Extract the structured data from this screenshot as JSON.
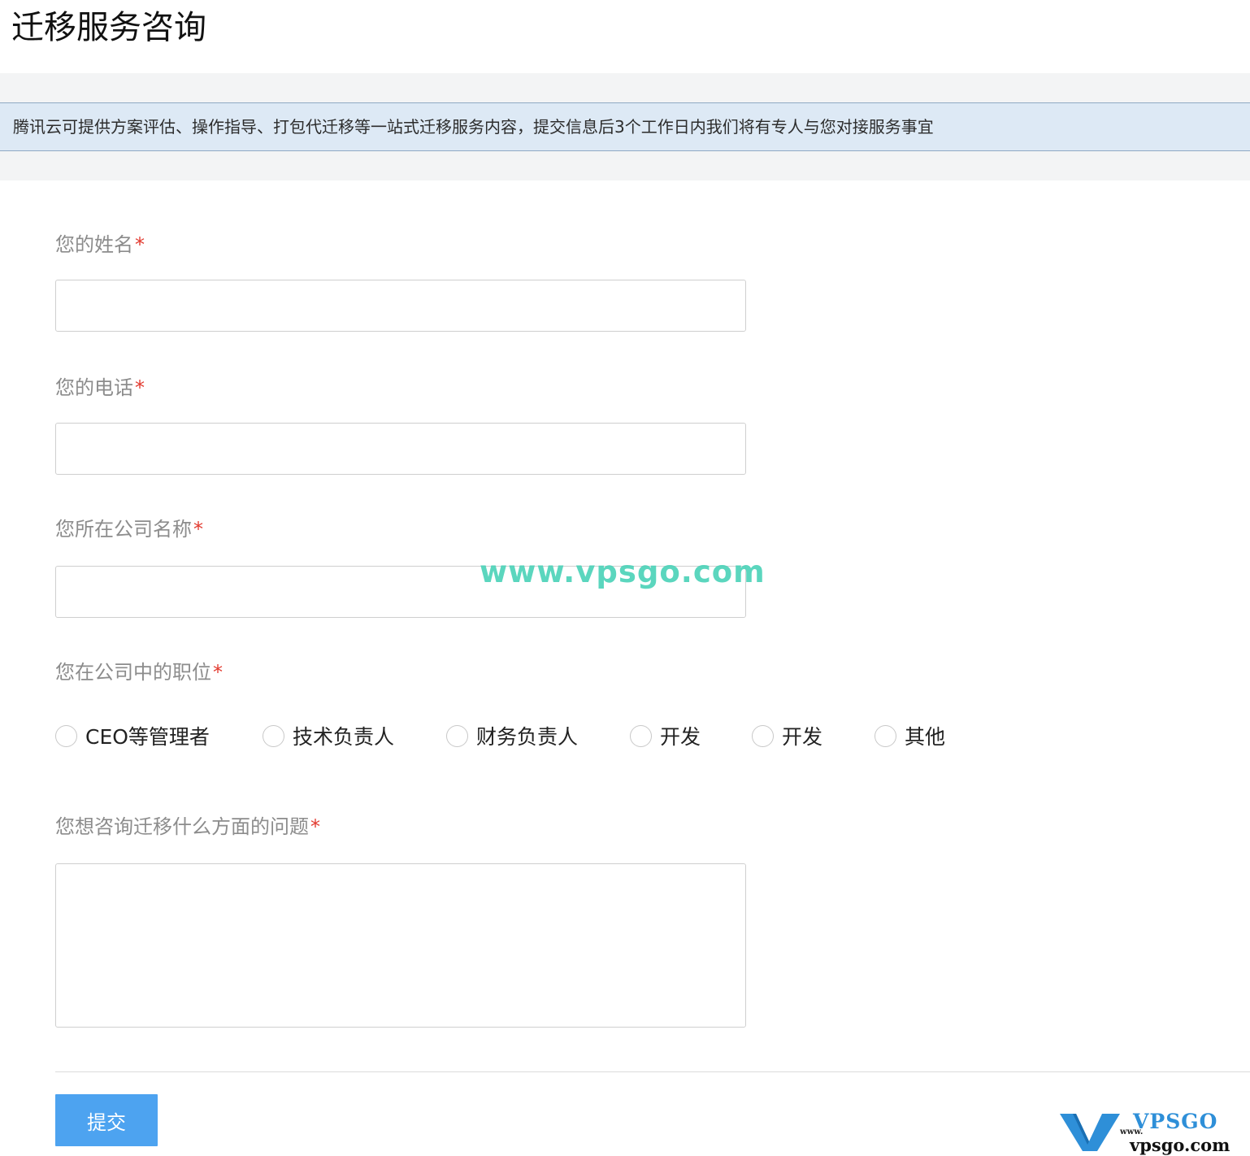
{
  "page": {
    "title": "迁移服务咨询",
    "notice": "腾讯云可提供方案评估、操作指导、打包代迁移等一站式迁移服务内容，提交信息后3个工作日内我们将有专人与您对接服务事宜"
  },
  "form": {
    "required_mark": "*",
    "name": {
      "label": "您的姓名",
      "value": ""
    },
    "phone": {
      "label": "您的电话",
      "value": ""
    },
    "company": {
      "label": "您所在公司名称",
      "value": ""
    },
    "position": {
      "label": "您在公司中的职位",
      "options": [
        "CEO等管理者",
        "技术负责人",
        "财务负责人",
        "开发",
        "开发",
        "其他"
      ],
      "selected": null
    },
    "question": {
      "label": "您想咨询迁移什么方面的问题",
      "value": ""
    },
    "submit_label": "提交"
  },
  "watermark": {
    "url_text": "www.vpsgo.com",
    "logo_brand": "VPSGO",
    "logo_www": "www.",
    "logo_domain": "vpsgo.com"
  },
  "colors": {
    "accent": "#4da3f0",
    "required": "#e23a2f",
    "notice_bg": "#dde9f5",
    "watermark": "#4ad2b8"
  }
}
